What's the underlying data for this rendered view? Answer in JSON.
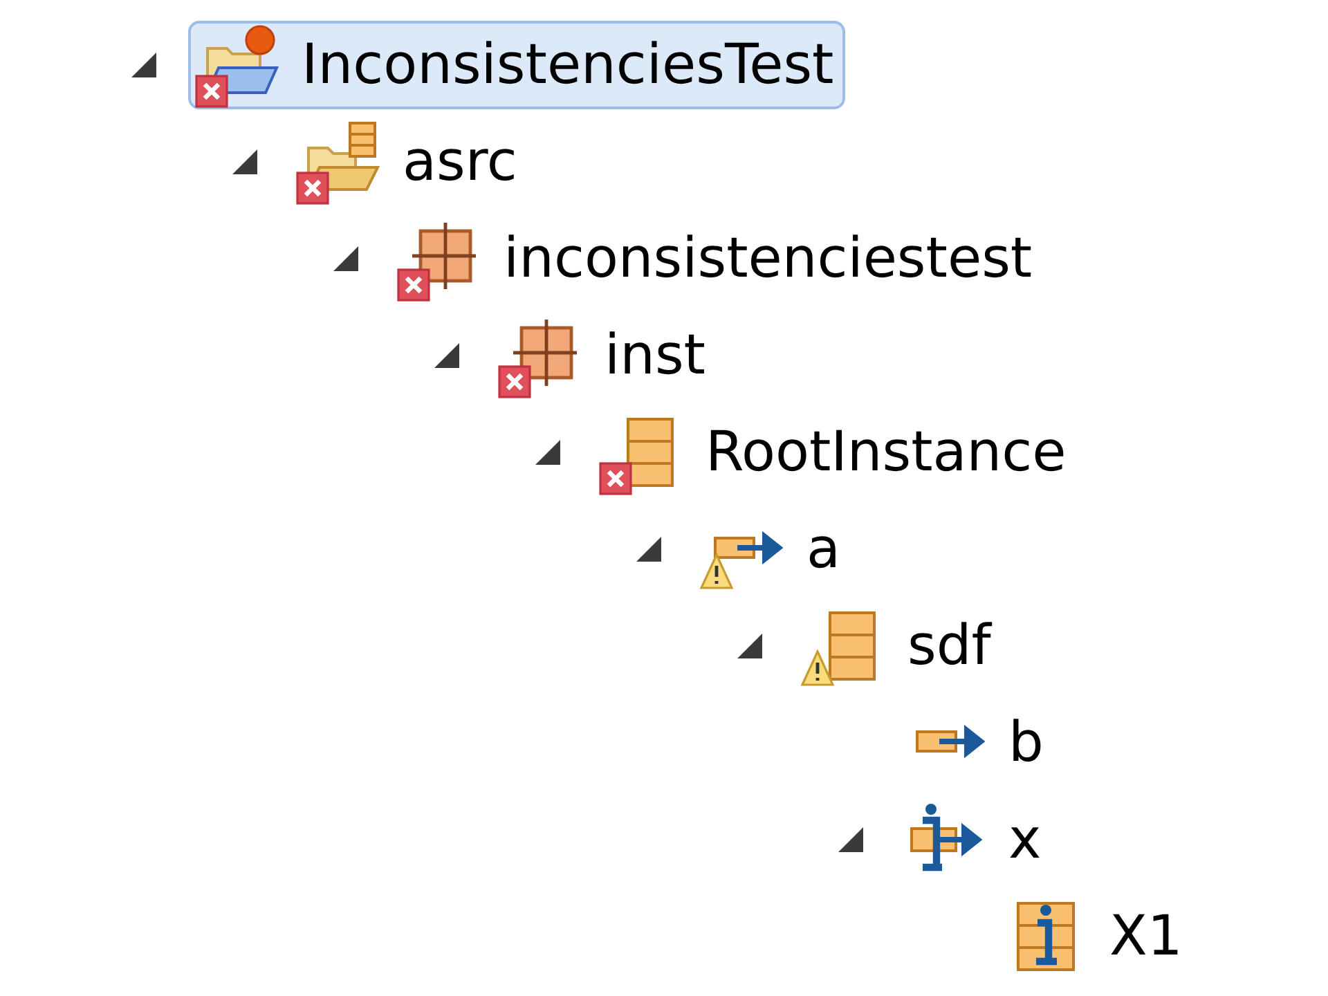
{
  "tree": [
    {
      "label": "InconsistenciesTest",
      "kind": "project",
      "error": true,
      "warning": false,
      "expanded": true,
      "selected": true,
      "children": [
        {
          "label": "asrc",
          "kind": "source-folder",
          "error": true,
          "warning": false,
          "expanded": true,
          "selected": false,
          "children": [
            {
              "label": "inconsistenciestest",
              "kind": "package",
              "error": true,
              "warning": false,
              "expanded": true,
              "selected": false,
              "children": [
                {
                  "label": "inst",
                  "kind": "package",
                  "error": true,
                  "warning": false,
                  "expanded": true,
                  "selected": false,
                  "children": [
                    {
                      "label": "RootInstance",
                      "kind": "class",
                      "error": true,
                      "warning": false,
                      "expanded": true,
                      "selected": false,
                      "children": [
                        {
                          "label": "a",
                          "kind": "field",
                          "error": false,
                          "warning": true,
                          "expanded": true,
                          "selected": false,
                          "children": [
                            {
                              "label": "sdf",
                              "kind": "class",
                              "error": false,
                              "warning": true,
                              "expanded": true,
                              "selected": false,
                              "children": [
                                {
                                  "label": "b",
                                  "kind": "field",
                                  "error": false,
                                  "warning": false,
                                  "selected": false
                                },
                                {
                                  "label": "x",
                                  "kind": "instance-field",
                                  "error": false,
                                  "warning": false,
                                  "expanded": true,
                                  "selected": false,
                                  "children": [
                                    {
                                      "label": "X1",
                                      "kind": "instance-class",
                                      "error": false,
                                      "warning": false,
                                      "selected": false
                                    }
                                  ]
                                }
                              ]
                            }
                          ]
                        }
                      ]
                    }
                  ]
                }
              ]
            }
          ]
        }
      ]
    }
  ]
}
